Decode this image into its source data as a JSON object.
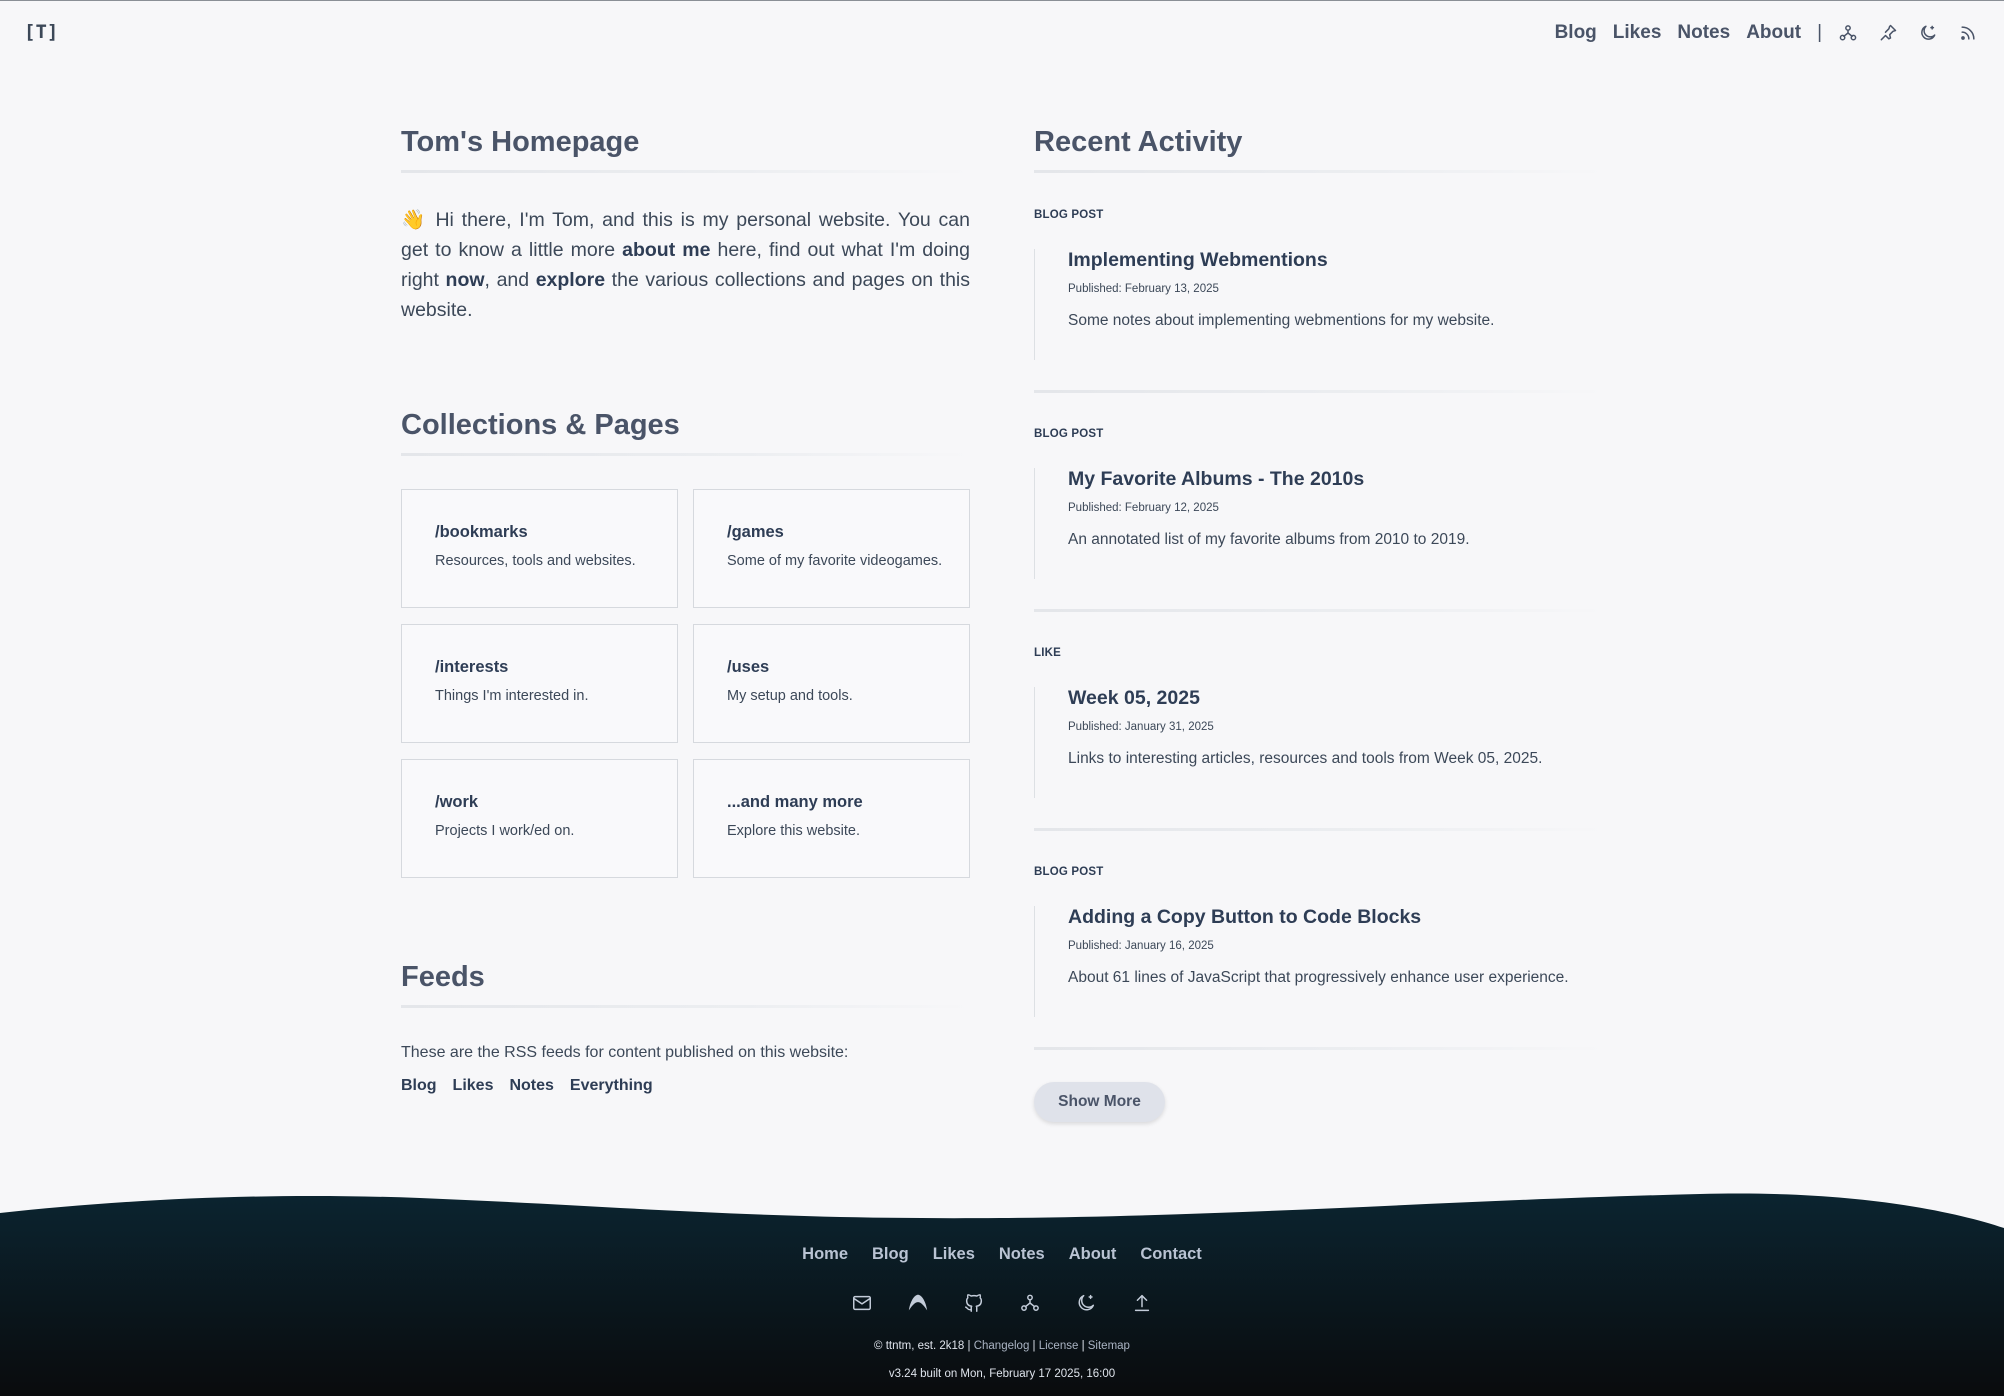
{
  "header": {
    "logo": "[T]",
    "nav": [
      "Blog",
      "Likes",
      "Notes",
      "About"
    ],
    "separator": "|",
    "icons": [
      "webring-icon",
      "pin-icon",
      "moon-icon",
      "rss-icon"
    ]
  },
  "intro": {
    "title": "Tom's Homepage",
    "wave": "👋",
    "text_1": " Hi there, I'm Tom, and this is my personal website. You can get to know a little more ",
    "link_about": "about me",
    "text_2": " here, find out what I'm doing right ",
    "link_now": "now",
    "text_3": ", and ",
    "link_explore": "explore",
    "text_4": " the various collections and pages on this website."
  },
  "collections": {
    "title": "Collections & Pages",
    "cards": [
      {
        "title": "/bookmarks",
        "desc": "Resources, tools and websites."
      },
      {
        "title": "/games",
        "desc": "Some of my favorite videogames."
      },
      {
        "title": "/interests",
        "desc": "Things I'm interested in."
      },
      {
        "title": "/uses",
        "desc": "My setup and tools."
      },
      {
        "title": "/work",
        "desc": "Projects I work/ed on."
      },
      {
        "title": "...and many more",
        "desc": "Explore this website."
      }
    ]
  },
  "feeds": {
    "title": "Feeds",
    "text": "These are the RSS feeds for content published on this website:",
    "links": [
      "Blog",
      "Likes",
      "Notes",
      "Everything"
    ]
  },
  "activity": {
    "title": "Recent Activity",
    "items": [
      {
        "type": "BLOG POST",
        "title": "Implementing Webmentions",
        "date": "Published: February 13, 2025",
        "desc": "Some notes about implementing webmentions for my website."
      },
      {
        "type": "BLOG POST",
        "title": "My Favorite Albums - The 2010s",
        "date": "Published: February 12, 2025",
        "desc": "An annotated list of my favorite albums from 2010 to 2019."
      },
      {
        "type": "LIKE",
        "title": "Week 05, 2025",
        "date": "Published: January 31, 2025",
        "desc": "Links to interesting articles, resources and tools from Week 05, 2025."
      },
      {
        "type": "BLOG POST",
        "title": "Adding a Copy Button to Code Blocks",
        "date": "Published: January 16, 2025",
        "desc": "About 61 lines of JavaScript that progressively enhance user experience."
      }
    ],
    "show_more": "Show More"
  },
  "footer": {
    "nav": [
      "Home",
      "Blog",
      "Likes",
      "Notes",
      "About",
      "Contact"
    ],
    "icons": [
      "mail-icon",
      "mastodon-icon",
      "github-icon",
      "webring-icon",
      "moon-icon",
      "upload-icon"
    ],
    "copyright": "© ttntm, est. 2k18 | ",
    "links": [
      "Changelog",
      "License",
      "Sitemap"
    ],
    "link_sep": " | ",
    "built": "v3.24 built on Mon, February 17 2025, 16:00",
    "colors": {
      "top": "#0b2430",
      "bottom": "#0a0b0d"
    }
  }
}
